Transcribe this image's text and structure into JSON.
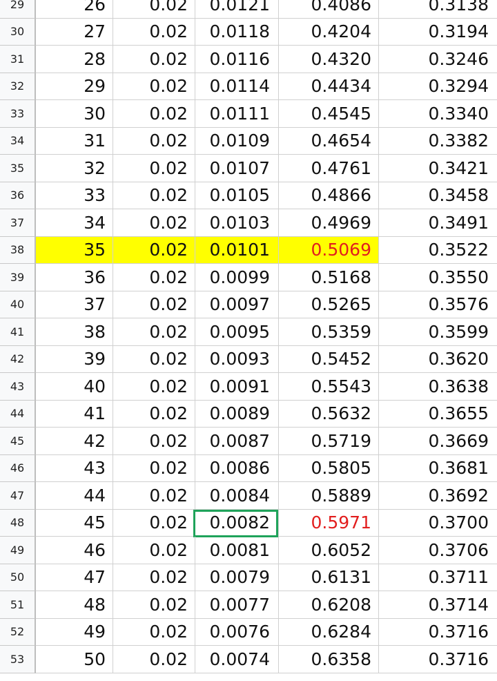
{
  "rows": [
    {
      "num": "29",
      "a": "26",
      "b": "0.02",
      "c": "0.0121",
      "d": "0.4086",
      "e": "0.3138"
    },
    {
      "num": "30",
      "a": "27",
      "b": "0.02",
      "c": "0.0118",
      "d": "0.4204",
      "e": "0.3194"
    },
    {
      "num": "31",
      "a": "28",
      "b": "0.02",
      "c": "0.0116",
      "d": "0.4320",
      "e": "0.3246"
    },
    {
      "num": "32",
      "a": "29",
      "b": "0.02",
      "c": "0.0114",
      "d": "0.4434",
      "e": "0.3294"
    },
    {
      "num": "33",
      "a": "30",
      "b": "0.02",
      "c": "0.0111",
      "d": "0.4545",
      "e": "0.3340"
    },
    {
      "num": "34",
      "a": "31",
      "b": "0.02",
      "c": "0.0109",
      "d": "0.4654",
      "e": "0.3382"
    },
    {
      "num": "35",
      "a": "32",
      "b": "0.02",
      "c": "0.0107",
      "d": "0.4761",
      "e": "0.3421"
    },
    {
      "num": "36",
      "a": "33",
      "b": "0.02",
      "c": "0.0105",
      "d": "0.4866",
      "e": "0.3458"
    },
    {
      "num": "37",
      "a": "34",
      "b": "0.02",
      "c": "0.0103",
      "d": "0.4969",
      "e": "0.3491"
    },
    {
      "num": "38",
      "a": "35",
      "b": "0.02",
      "c": "0.0101",
      "d": "0.5069",
      "e": "0.3522"
    },
    {
      "num": "39",
      "a": "36",
      "b": "0.02",
      "c": "0.0099",
      "d": "0.5168",
      "e": "0.3550"
    },
    {
      "num": "40",
      "a": "37",
      "b": "0.02",
      "c": "0.0097",
      "d": "0.5265",
      "e": "0.3576"
    },
    {
      "num": "41",
      "a": "38",
      "b": "0.02",
      "c": "0.0095",
      "d": "0.5359",
      "e": "0.3599"
    },
    {
      "num": "42",
      "a": "39",
      "b": "0.02",
      "c": "0.0093",
      "d": "0.5452",
      "e": "0.3620"
    },
    {
      "num": "43",
      "a": "40",
      "b": "0.02",
      "c": "0.0091",
      "d": "0.5543",
      "e": "0.3638"
    },
    {
      "num": "44",
      "a": "41",
      "b": "0.02",
      "c": "0.0089",
      "d": "0.5632",
      "e": "0.3655"
    },
    {
      "num": "45",
      "a": "42",
      "b": "0.02",
      "c": "0.0087",
      "d": "0.5719",
      "e": "0.3669"
    },
    {
      "num": "46",
      "a": "43",
      "b": "0.02",
      "c": "0.0086",
      "d": "0.5805",
      "e": "0.3681"
    },
    {
      "num": "47",
      "a": "44",
      "b": "0.02",
      "c": "0.0084",
      "d": "0.5889",
      "e": "0.3692"
    },
    {
      "num": "48",
      "a": "45",
      "b": "0.02",
      "c": "0.0082",
      "d": "0.5971",
      "e": "0.3700"
    },
    {
      "num": "49",
      "a": "46",
      "b": "0.02",
      "c": "0.0081",
      "d": "0.6052",
      "e": "0.3706"
    },
    {
      "num": "50",
      "a": "47",
      "b": "0.02",
      "c": "0.0079",
      "d": "0.6131",
      "e": "0.3711"
    },
    {
      "num": "51",
      "a": "48",
      "b": "0.02",
      "c": "0.0077",
      "d": "0.6208",
      "e": "0.3714"
    },
    {
      "num": "52",
      "a": "49",
      "b": "0.02",
      "c": "0.0076",
      "d": "0.6284",
      "e": "0.3716"
    },
    {
      "num": "53",
      "a": "50",
      "b": "0.02",
      "c": "0.0074",
      "d": "0.6358",
      "e": "0.3716"
    }
  ],
  "highlight_row": "38",
  "highlight_color": "#ffff00",
  "red_value_rows": [
    "38",
    "48"
  ],
  "red_text_color": "#e21e1e",
  "selected_cell": {
    "row": "48",
    "column": "c"
  },
  "selection_color": "#1fa35a"
}
